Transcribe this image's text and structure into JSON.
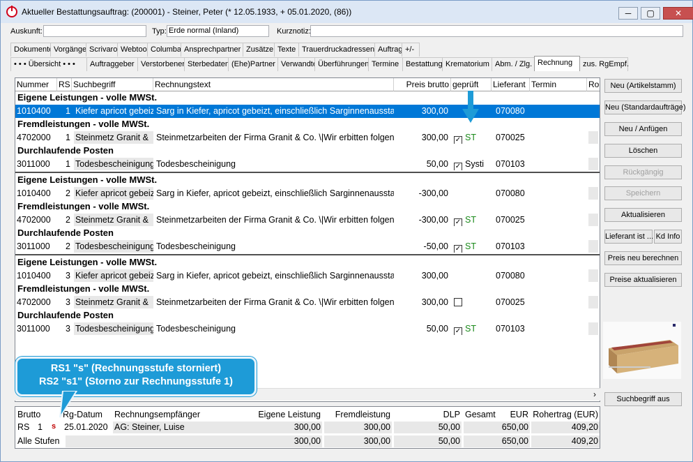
{
  "window": {
    "title": "Aktueller Bestattungsauftrag: (200001) - Steiner, Peter (* 12.05.1933, + 05.01.2020, (86))",
    "min": "─",
    "max": "▢",
    "close": "✕"
  },
  "fields": {
    "auskunft_label": "Auskunft:",
    "auskunft_value": "",
    "typ_label": "Typ:",
    "typ_value": "Erde normal (Inland)",
    "kurznotiz_label": "Kurznotiz:",
    "kurznotiz_value": ""
  },
  "tabs1": [
    "Dokumente",
    "Vorgänge",
    "Scrivaro",
    "Webtool",
    "Columba",
    "Ansprechpartner",
    "Zusätze",
    "Texte",
    "Trauerdruckadressen",
    "Auftrag",
    "+/-"
  ],
  "tabs2": [
    "• • •  Übersicht  • • •",
    "Auftraggeber",
    "Verstorbener",
    "Sterbedaten",
    "(Ehe)Partner",
    "Verwandte",
    "Überführungen",
    "Termine",
    "Bestattung",
    "Krematorium",
    "Abm. / Zlg.",
    "Rechnung",
    "zus. RgEmpf."
  ],
  "grid": {
    "headers": [
      "Nummer",
      "RS",
      "Suchbegriff",
      "Rechnungstext",
      "Preis brutto",
      "geprüft",
      "Lieferant",
      "Termin",
      "Ro"
    ],
    "rows": [
      {
        "group": "Eigene Leistungen - volle MWSt."
      },
      {
        "nr": "1010400",
        "rs": "1",
        "such": "Kiefer apricot gebeizt",
        "text": "Sarg in Kiefer, apricot gebeizt, einschließlich Sarginnenausstattung",
        "preis": "300,00",
        "chk": "",
        "st": "",
        "lief": "070080",
        "sel": true
      },
      {
        "group": "Fremdleistungen - volle MWSt."
      },
      {
        "nr": "4702000",
        "rs": "1",
        "such": "Steinmetz Granit &",
        "text": "Steinmetzarbeiten der Firma Granit & Co. \\|Wir erbitten folgende",
        "preis": "300,00",
        "chk": "✓",
        "st": "ST",
        "lief": "070025"
      },
      {
        "group": "Durchlaufende Posten"
      },
      {
        "nr": "3011000",
        "rs": "1",
        "such": "Todesbescheinigung",
        "text": "Todesbescheinigung",
        "preis": "50,00",
        "chk": "✓",
        "st": "Systi",
        "lief": "070103",
        "stblack": true
      },
      {
        "sep": true
      },
      {
        "group": "Eigene Leistungen - volle MWSt."
      },
      {
        "nr": "1010400",
        "rs": "2",
        "such": "Kiefer apricot gebeizt",
        "text": "Sarg in Kiefer, apricot gebeizt, einschließlich Sarginnenausstattung",
        "preis": "-300,00",
        "chk": "",
        "st": "",
        "lief": "070080"
      },
      {
        "group": "Fremdleistungen - volle MWSt."
      },
      {
        "nr": "4702000",
        "rs": "2",
        "such": "Steinmetz Granit &",
        "text": "Steinmetzarbeiten der Firma Granit & Co. \\|Wir erbitten folgende",
        "preis": "-300,00",
        "chk": "✓",
        "st": "ST",
        "lief": "070025"
      },
      {
        "group": "Durchlaufende Posten"
      },
      {
        "nr": "3011000",
        "rs": "2",
        "such": "Todesbescheinigung",
        "text": "Todesbescheinigung",
        "preis": "-50,00",
        "chk": "✓",
        "st": "ST",
        "lief": "070103"
      },
      {
        "sep": true
      },
      {
        "group": "Eigene Leistungen - volle MWSt."
      },
      {
        "nr": "1010400",
        "rs": "3",
        "such": "Kiefer apricot gebeizt",
        "text": "Sarg in Kiefer, apricot gebeizt, einschließlich Sarginnenausstattung",
        "preis": "300,00",
        "chk": "",
        "st": "",
        "lief": "070080"
      },
      {
        "group": "Fremdleistungen - volle MWSt."
      },
      {
        "nr": "4702000",
        "rs": "3",
        "such": "Steinmetz Granit &",
        "text": "Steinmetzarbeiten der Firma Granit & Co. \\|Wir erbitten folgende",
        "preis": "300,00",
        "chk": "☐",
        "st": "",
        "lief": "070025",
        "empty": true
      },
      {
        "group": "Durchlaufende Posten"
      },
      {
        "nr": "3011000",
        "rs": "3",
        "such": "Todesbescheinigung",
        "text": "Todesbescheinigung",
        "preis": "50,00",
        "chk": "✓",
        "st": "ST",
        "lief": "070103"
      }
    ]
  },
  "buttons": [
    "Neu (Artikelstamm)",
    "Neu (Standardaufträge)",
    "Neu / Anfügen",
    "Löschen",
    "Rückgängig",
    "Speichern",
    "Aktualisieren",
    "Lieferant ist ...",
    "Kd Info",
    "Preis neu berechnen",
    "Preise aktualisieren",
    "Suchbegriff aus"
  ],
  "summary": {
    "headers": [
      "Brutto",
      "Rg-Datum",
      "Rechnungsempfänger",
      "Eigene Leistung",
      "Fremdleistung",
      "DLP",
      "Gesamt",
      "EUR",
      "Rohertrag (EUR)"
    ],
    "row1": {
      "label": "RS",
      "num": "1",
      "flag": "s",
      "date": "25.01.2020",
      "empf": "AG: Steiner, Luise",
      "eigen": "300,00",
      "fremd": "300,00",
      "dlp": "50,00",
      "ges": "650,00",
      "roh": "409,20"
    },
    "row2": {
      "label": "Alle Stufen",
      "eigen": "300,00",
      "fremd": "300,00",
      "dlp": "50,00",
      "ges": "650,00",
      "roh": "409,20"
    }
  },
  "callout": {
    "line1": "RS1 \"s\" (Rechnungsstufe storniert)",
    "line2": "RS2 \"s1\" (Storno zur Rechnungsstufe 1)"
  },
  "colors": {
    "selection": "#0078d7",
    "callout": "#1e9bd7",
    "arrow": "#1e9bd7",
    "flag": "#c00000",
    "status": "#1a8a1a"
  }
}
